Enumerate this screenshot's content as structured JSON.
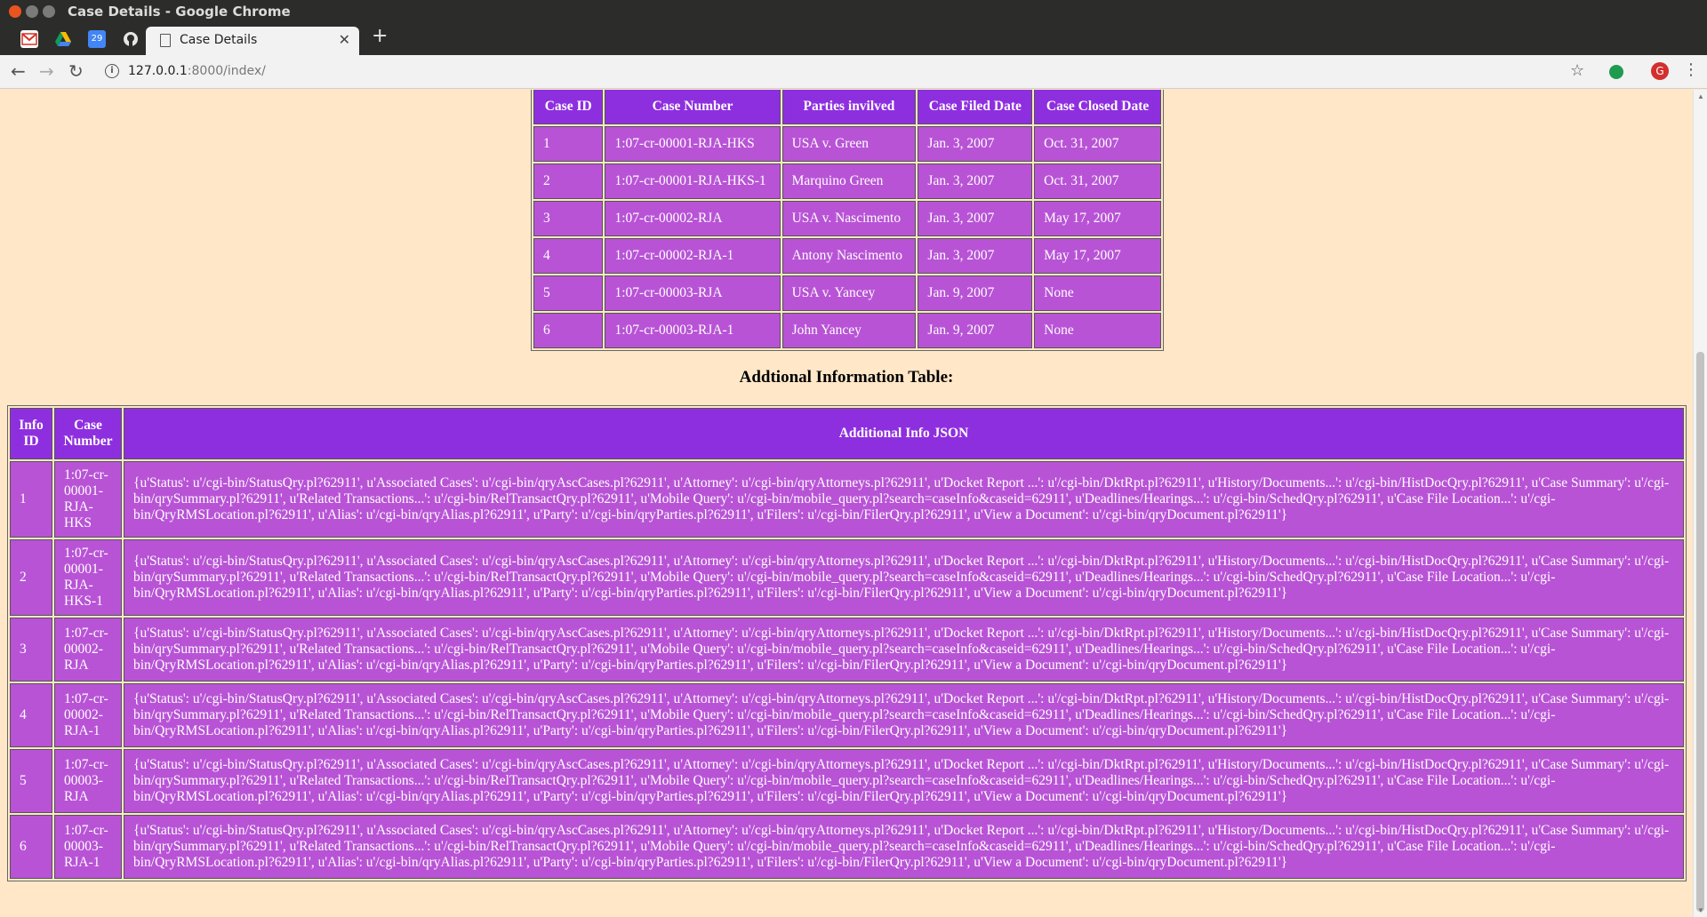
{
  "window": {
    "title": "Case Details - Google Chrome"
  },
  "tabs": {
    "active_label": "Case Details",
    "pinned_icons": [
      "gmail-icon",
      "drive-icon",
      "calendar-icon",
      "github-icon"
    ],
    "calendar_day": "29"
  },
  "toolbar": {
    "url_host": "127.0.0.1",
    "url_path": ":8000/index/",
    "avatar_letter": "G"
  },
  "cases_table": {
    "headers": [
      "Case ID",
      "Case Number",
      "Parties invilved",
      "Case Filed Date",
      "Case Closed Date"
    ],
    "rows": [
      [
        "1",
        "1:07-cr-00001-RJA-HKS",
        "USA v. Green",
        "Jan. 3, 2007",
        "Oct. 31, 2007"
      ],
      [
        "2",
        "1:07-cr-00001-RJA-HKS-1",
        "Marquino Green",
        "Jan. 3, 2007",
        "Oct. 31, 2007"
      ],
      [
        "3",
        "1:07-cr-00002-RJA",
        "USA v. Nascimento",
        "Jan. 3, 2007",
        "May 17, 2007"
      ],
      [
        "4",
        "1:07-cr-00002-RJA-1",
        "Antony Nascimento",
        "Jan. 3, 2007",
        "May 17, 2007"
      ],
      [
        "5",
        "1:07-cr-00003-RJA",
        "USA v. Yancey",
        "Jan. 9, 2007",
        "None"
      ],
      [
        "6",
        "1:07-cr-00003-RJA-1",
        "John Yancey",
        "Jan. 9, 2007",
        "None"
      ]
    ]
  },
  "info_section": {
    "title": "Addtional Information Table:"
  },
  "info_table": {
    "headers": [
      "Info ID",
      "Case Number",
      "Additional Info JSON"
    ],
    "rows": [
      [
        "1",
        "1:07-cr-00001-RJA-HKS",
        "{u'Status': u'/cgi-bin/StatusQry.pl?62911', u'Associated Cases': u'/cgi-bin/qryAscCases.pl?62911', u'Attorney': u'/cgi-bin/qryAttorneys.pl?62911', u'Docket Report ...': u'/cgi-bin/DktRpt.pl?62911', u'History/Documents...': u'/cgi-bin/HistDocQry.pl?62911', u'Case Summary': u'/cgi-bin/qrySummary.pl?62911', u'Related Transactions...': u'/cgi-bin/RelTransactQry.pl?62911', u'Mobile Query': u'/cgi-bin/mobile_query.pl?search=caseInfo&caseid=62911', u'Deadlines/Hearings...': u'/cgi-bin/SchedQry.pl?62911', u'Case File Location...': u'/cgi-bin/QryRMSLocation.pl?62911', u'Alias': u'/cgi-bin/qryAlias.pl?62911', u'Party': u'/cgi-bin/qryParties.pl?62911', u'Filers': u'/cgi-bin/FilerQry.pl?62911', u'View a Document': u'/cgi-bin/qryDocument.pl?62911'}"
      ],
      [
        "2",
        "1:07-cr-00001-RJA-HKS-1",
        "{u'Status': u'/cgi-bin/StatusQry.pl?62911', u'Associated Cases': u'/cgi-bin/qryAscCases.pl?62911', u'Attorney': u'/cgi-bin/qryAttorneys.pl?62911', u'Docket Report ...': u'/cgi-bin/DktRpt.pl?62911', u'History/Documents...': u'/cgi-bin/HistDocQry.pl?62911', u'Case Summary': u'/cgi-bin/qrySummary.pl?62911', u'Related Transactions...': u'/cgi-bin/RelTransactQry.pl?62911', u'Mobile Query': u'/cgi-bin/mobile_query.pl?search=caseInfo&caseid=62911', u'Deadlines/Hearings...': u'/cgi-bin/SchedQry.pl?62911', u'Case File Location...': u'/cgi-bin/QryRMSLocation.pl?62911', u'Alias': u'/cgi-bin/qryAlias.pl?62911', u'Party': u'/cgi-bin/qryParties.pl?62911', u'Filers': u'/cgi-bin/FilerQry.pl?62911', u'View a Document': u'/cgi-bin/qryDocument.pl?62911'}"
      ],
      [
        "3",
        "1:07-cr-00002-RJA",
        "{u'Status': u'/cgi-bin/StatusQry.pl?62911', u'Associated Cases': u'/cgi-bin/qryAscCases.pl?62911', u'Attorney': u'/cgi-bin/qryAttorneys.pl?62911', u'Docket Report ...': u'/cgi-bin/DktRpt.pl?62911', u'History/Documents...': u'/cgi-bin/HistDocQry.pl?62911', u'Case Summary': u'/cgi-bin/qrySummary.pl?62911', u'Related Transactions...': u'/cgi-bin/RelTransactQry.pl?62911', u'Mobile Query': u'/cgi-bin/mobile_query.pl?search=caseInfo&caseid=62911', u'Deadlines/Hearings...': u'/cgi-bin/SchedQry.pl?62911', u'Case File Location...': u'/cgi-bin/QryRMSLocation.pl?62911', u'Alias': u'/cgi-bin/qryAlias.pl?62911', u'Party': u'/cgi-bin/qryParties.pl?62911', u'Filers': u'/cgi-bin/FilerQry.pl?62911', u'View a Document': u'/cgi-bin/qryDocument.pl?62911'}"
      ],
      [
        "4",
        "1:07-cr-00002-RJA-1",
        "{u'Status': u'/cgi-bin/StatusQry.pl?62911', u'Associated Cases': u'/cgi-bin/qryAscCases.pl?62911', u'Attorney': u'/cgi-bin/qryAttorneys.pl?62911', u'Docket Report ...': u'/cgi-bin/DktRpt.pl?62911', u'History/Documents...': u'/cgi-bin/HistDocQry.pl?62911', u'Case Summary': u'/cgi-bin/qrySummary.pl?62911', u'Related Transactions...': u'/cgi-bin/RelTransactQry.pl?62911', u'Mobile Query': u'/cgi-bin/mobile_query.pl?search=caseInfo&caseid=62911', u'Deadlines/Hearings...': u'/cgi-bin/SchedQry.pl?62911', u'Case File Location...': u'/cgi-bin/QryRMSLocation.pl?62911', u'Alias': u'/cgi-bin/qryAlias.pl?62911', u'Party': u'/cgi-bin/qryParties.pl?62911', u'Filers': u'/cgi-bin/FilerQry.pl?62911', u'View a Document': u'/cgi-bin/qryDocument.pl?62911'}"
      ],
      [
        "5",
        "1:07-cr-00003-RJA",
        "{u'Status': u'/cgi-bin/StatusQry.pl?62911', u'Associated Cases': u'/cgi-bin/qryAscCases.pl?62911', u'Attorney': u'/cgi-bin/qryAttorneys.pl?62911', u'Docket Report ...': u'/cgi-bin/DktRpt.pl?62911', u'History/Documents...': u'/cgi-bin/HistDocQry.pl?62911', u'Case Summary': u'/cgi-bin/qrySummary.pl?62911', u'Related Transactions...': u'/cgi-bin/RelTransactQry.pl?62911', u'Mobile Query': u'/cgi-bin/mobile_query.pl?search=caseInfo&caseid=62911', u'Deadlines/Hearings...': u'/cgi-bin/SchedQry.pl?62911', u'Case File Location...': u'/cgi-bin/QryRMSLocation.pl?62911', u'Alias': u'/cgi-bin/qryAlias.pl?62911', u'Party': u'/cgi-bin/qryParties.pl?62911', u'Filers': u'/cgi-bin/FilerQry.pl?62911', u'View a Document': u'/cgi-bin/qryDocument.pl?62911'}"
      ],
      [
        "6",
        "1:07-cr-00003-RJA-1",
        "{u'Status': u'/cgi-bin/StatusQry.pl?62911', u'Associated Cases': u'/cgi-bin/qryAscCases.pl?62911', u'Attorney': u'/cgi-bin/qryAttorneys.pl?62911', u'Docket Report ...': u'/cgi-bin/DktRpt.pl?62911', u'History/Documents...': u'/cgi-bin/HistDocQry.pl?62911', u'Case Summary': u'/cgi-bin/qrySummary.pl?62911', u'Related Transactions...': u'/cgi-bin/RelTransactQry.pl?62911', u'Mobile Query': u'/cgi-bin/mobile_query.pl?search=caseInfo&caseid=62911', u'Deadlines/Hearings...': u'/cgi-bin/SchedQry.pl?62911', u'Case File Location...': u'/cgi-bin/QryRMSLocation.pl?62911', u'Alias': u'/cgi-bin/qryAlias.pl?62911', u'Party': u'/cgi-bin/qryParties.pl?62911', u'Filers': u'/cgi-bin/FilerQry.pl?62911', u'View a Document': u'/cgi-bin/qryDocument.pl?62911'}"
      ]
    ]
  },
  "colors": {
    "page_background": "#ffe7c8",
    "header_cell": "#8e2fdf",
    "body_cell": "#b853d6"
  }
}
